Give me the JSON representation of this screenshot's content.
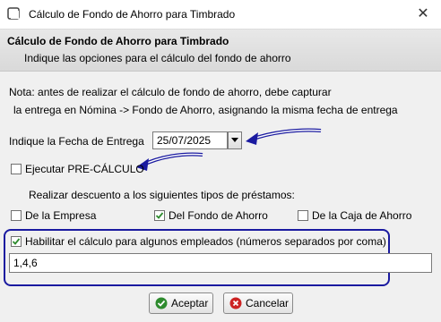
{
  "window": {
    "title": "Cálculo de Fondo de Ahorro para Timbrado",
    "close_glyph": "✕"
  },
  "header": {
    "title": "Cálculo de Fondo de Ahorro para Timbrado",
    "subtitle": "Indique las opciones para el cálculo del fondo de ahorro"
  },
  "note": {
    "line1": "Nota: antes de realizar el cálculo de fondo de ahorro, debe capturar",
    "line2": "la entrega en Nómina -> Fondo de Ahorro, asignando la misma fecha de entrega"
  },
  "date": {
    "label": "Indique la Fecha de Entrega",
    "value": "25/07/2025"
  },
  "precalc": {
    "label": "Ejecutar PRE-CÁLCULO",
    "checked": false
  },
  "loans": {
    "label": "Realizar descuento a los siguientes tipos de préstamos:",
    "options": [
      {
        "label": "De la Empresa",
        "checked": false
      },
      {
        "label": "Del Fondo de Ahorro",
        "checked": true
      },
      {
        "label": "De la Caja de Ahorro",
        "checked": false
      }
    ]
  },
  "employees": {
    "label": "Habilitar el cálculo para algunos empleados (números separados por coma)",
    "checked": true,
    "value": "1,4,6"
  },
  "buttons": {
    "accept": "Aceptar",
    "cancel": "Cancelar"
  },
  "colors": {
    "annotation_blue": "#1a1aa0",
    "check_green": "#2e8b2e",
    "cancel_red": "#cc2222"
  }
}
